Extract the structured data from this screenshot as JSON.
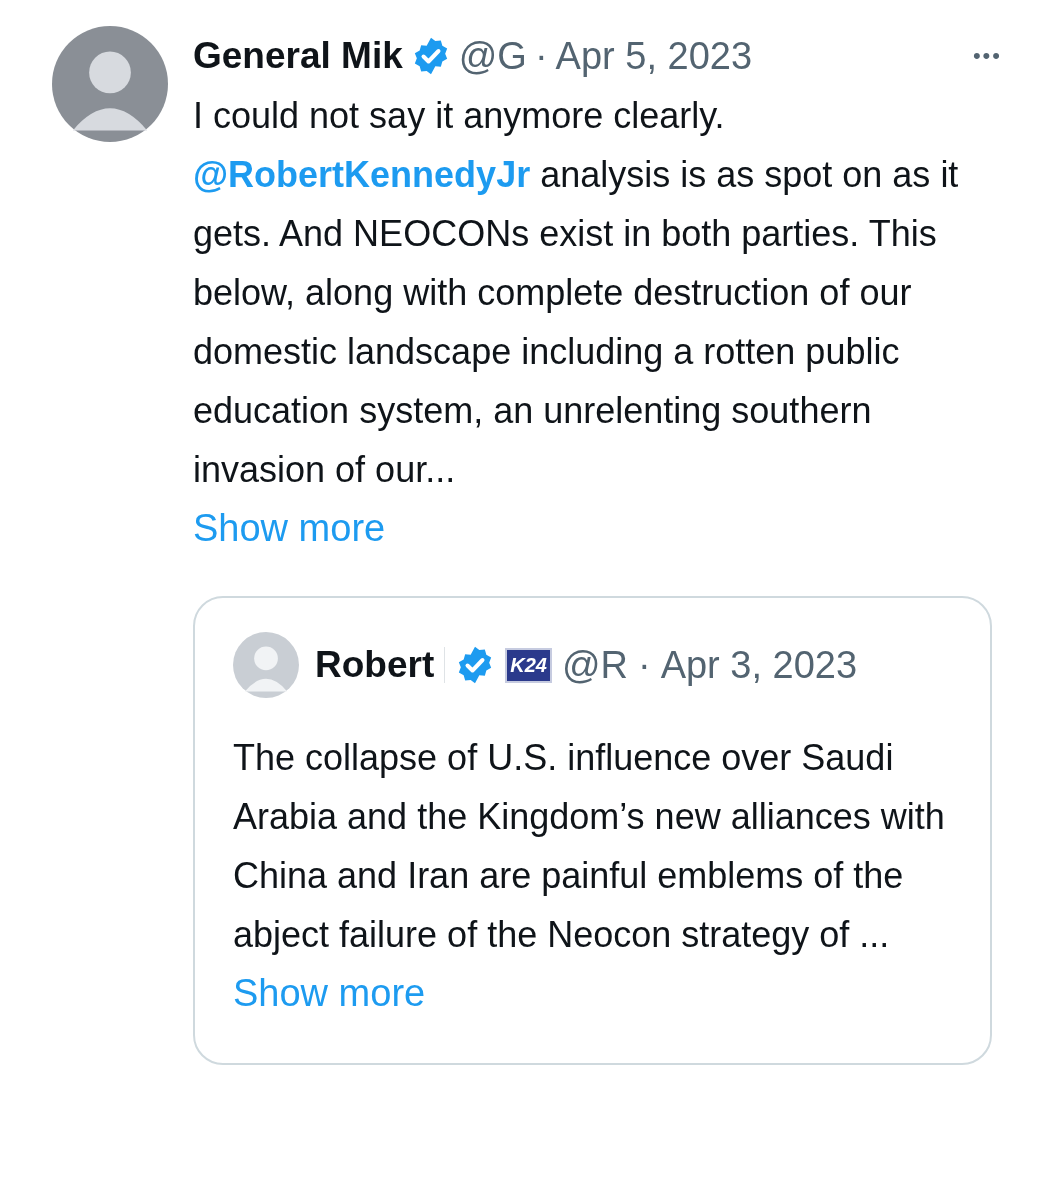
{
  "tweet": {
    "author": {
      "name": "General Mik",
      "verified": true,
      "handle": "@G"
    },
    "separator": "·",
    "date": "Apr 5, 2023",
    "more_menu": "•••",
    "body": [
      {
        "kind": "text",
        "text": "I could not say it anymore clearly.\n"
      },
      {
        "kind": "mention",
        "text": "@RobertKennedyJr"
      },
      {
        "kind": "text",
        "text": " analysis is as spot on as it gets. And NEOCONs exist in both parties. This below, along with complete destruction of our domestic landscape including a rotten public education system, an unrelenting southern invasion of our..."
      }
    ],
    "show_more": "Show more",
    "quoted_tweet": {
      "author": {
        "name": "Robert",
        "verified": true,
        "affiliate_badge": "K24",
        "handle": "@R"
      },
      "separator": "·",
      "date": "Apr 3, 2023",
      "body": "The collapse of U.S. influence over Saudi Arabia and the Kingdom’s new alliances with China and Iran are painful emblems of the abject failure of the Neocon strategy of ...",
      "show_more": "Show more"
    }
  }
}
